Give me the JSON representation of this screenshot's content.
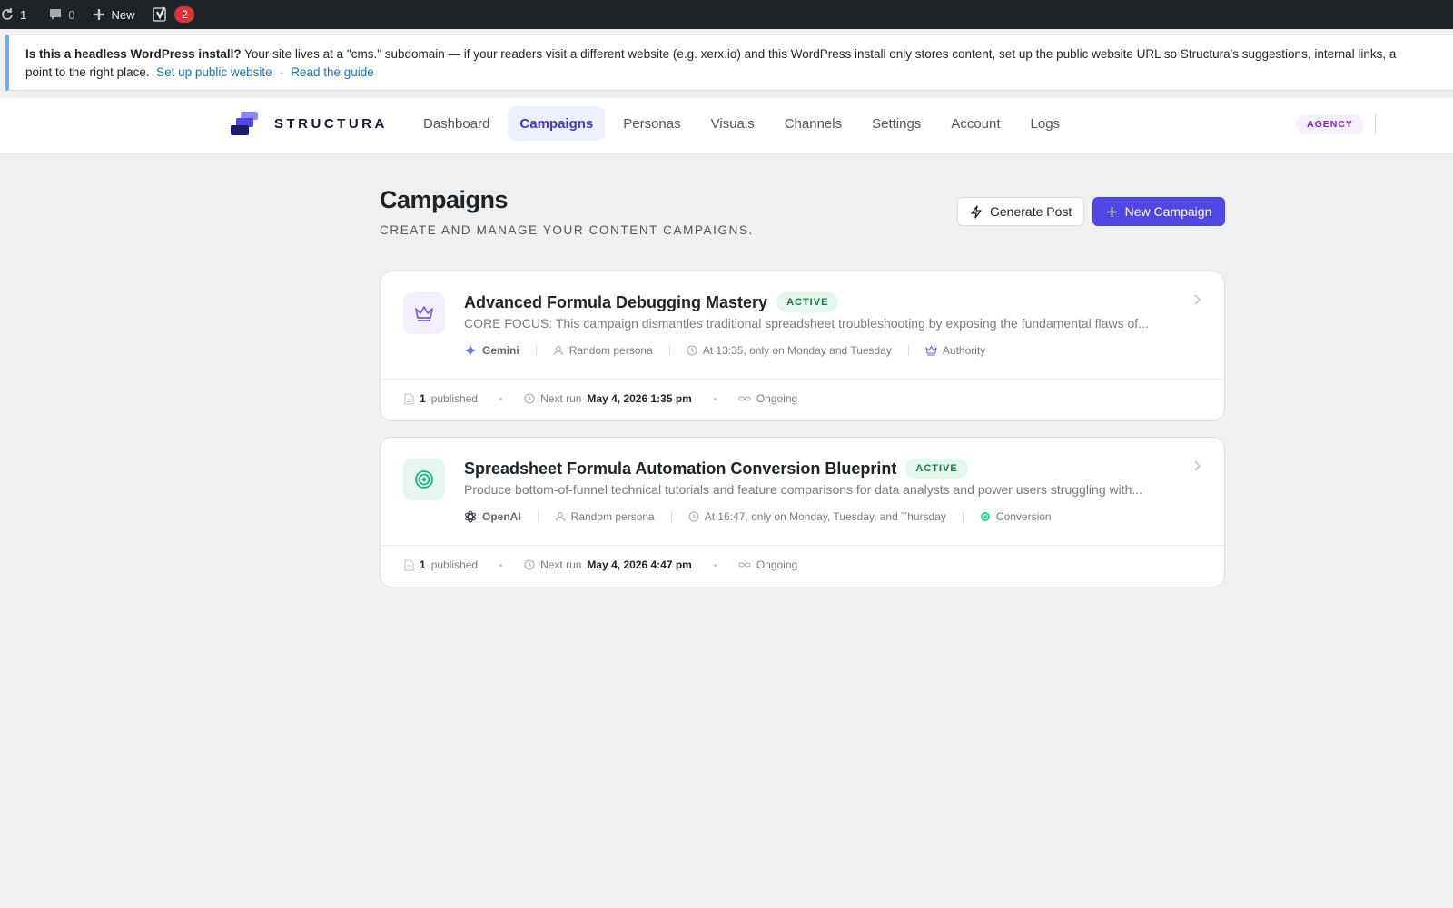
{
  "admin_bar": {
    "updates_count": "1",
    "comments_count": "0",
    "new_label": "New",
    "yoast_count": "2"
  },
  "notice": {
    "bold": "Is this a headless WordPress install?",
    "text": "Your site lives at a \"cms.\" subdomain — if your readers visit a different website (e.g. xerx.io) and this WordPress install only stores content, set up the public website URL so Structura's suggestions, internal links, a",
    "text_line2": "point to the right place.",
    "link_setup": "Set up public website",
    "separator": "·",
    "link_guide": "Read the guide"
  },
  "header": {
    "brand": "STRUCTURA",
    "nav": [
      {
        "label": "Dashboard",
        "active": false
      },
      {
        "label": "Campaigns",
        "active": true
      },
      {
        "label": "Personas",
        "active": false
      },
      {
        "label": "Visuals",
        "active": false
      },
      {
        "label": "Channels",
        "active": false
      },
      {
        "label": "Settings",
        "active": false
      },
      {
        "label": "Account",
        "active": false
      },
      {
        "label": "Logs",
        "active": false
      }
    ],
    "plan_badge": "AGENCY"
  },
  "page": {
    "title": "Campaigns",
    "subtitle": "CREATE AND MANAGE YOUR CONTENT CAMPAIGNS.",
    "generate_post_label": "Generate Post",
    "new_campaign_label": "New Campaign"
  },
  "campaigns": [
    {
      "title": "Advanced Formula Debugging Mastery",
      "status": "ACTIVE",
      "icon": "crown-icon",
      "description": "CORE FOCUS: This campaign dismantles traditional spreadsheet troubleshooting by exposing the fundamental flaws of...",
      "provider": "Gemini",
      "persona": "Random persona",
      "schedule": "At 13:35, only on Monday and Tuesday",
      "goal": "Authority",
      "published_count": "1",
      "published_label": "published",
      "next_run_label": "Next run",
      "next_run": "May 4, 2026 1:35 pm",
      "duration": "Ongoing"
    },
    {
      "title": "Spreadsheet Formula Automation Conversion Blueprint",
      "status": "ACTIVE",
      "icon": "target-icon",
      "description": "Produce bottom-of-funnel technical tutorials and feature comparisons for data analysts and power users struggling with...",
      "provider": "OpenAI",
      "persona": "Random persona",
      "schedule": "At 16:47, only on Monday, Tuesday, and Thursday",
      "goal": "Conversion",
      "published_count": "1",
      "published_label": "published",
      "next_run_label": "Next run",
      "next_run": "May 4, 2026 4:47 pm",
      "duration": "Ongoing"
    }
  ],
  "colors": {
    "accent": "#4f46e5",
    "active_nav_bg": "#eef0fc",
    "status_green": "#0f7a4c",
    "admin_bar": "#1d2327"
  }
}
